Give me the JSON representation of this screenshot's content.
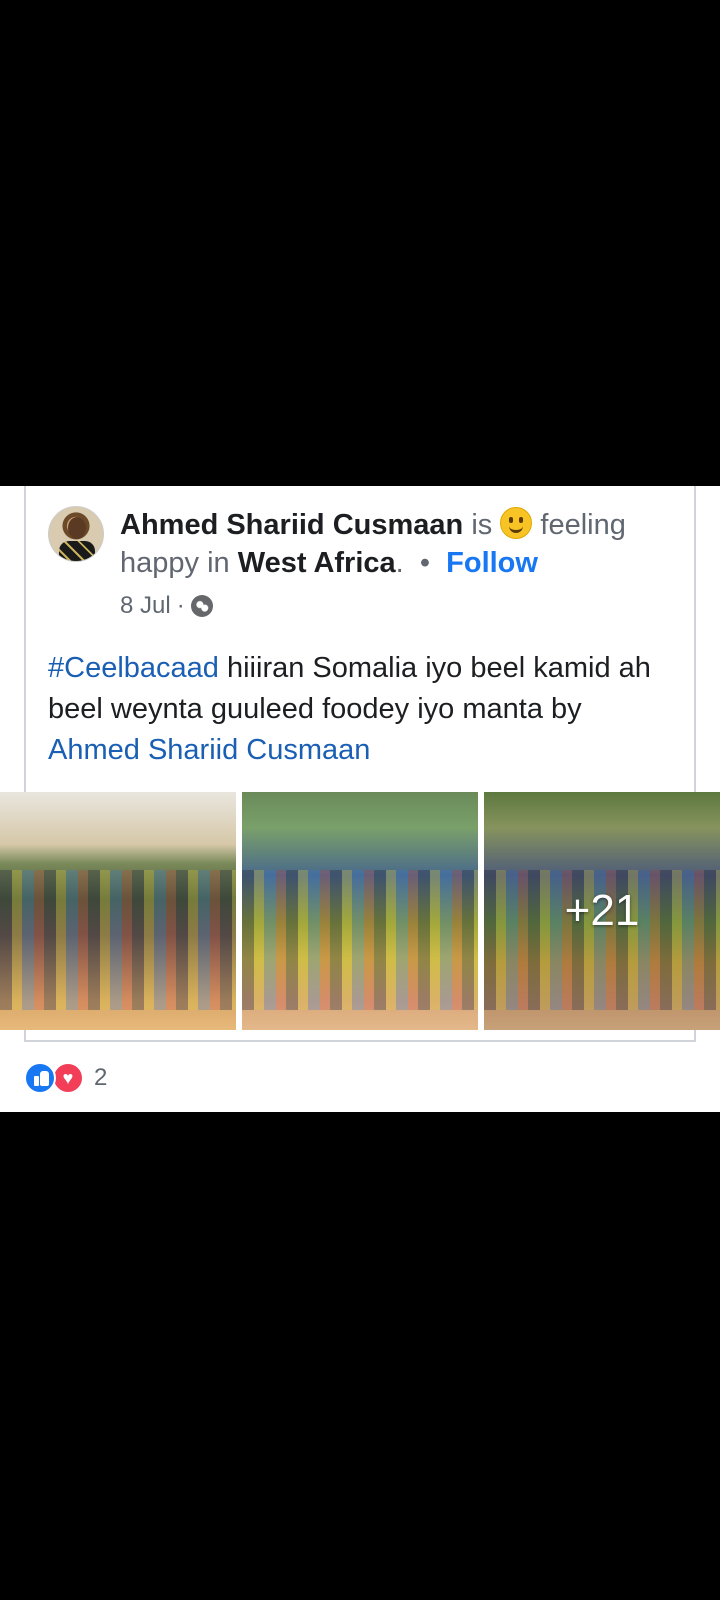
{
  "post": {
    "author": "Ahmed Shariid Cusmaan",
    "is_text": "is",
    "feeling_text": "feeling",
    "feeling_value": "happy",
    "in_text": "in",
    "location": "West Africa",
    "period": ".",
    "separator": "•",
    "follow_label": "Follow",
    "date": "8 Jul",
    "date_separator": "·",
    "privacy_icon": "globe-icon",
    "feeling_icon": "smiley-icon",
    "hashtag": "#Ceelbacaad",
    "body": "hiiiran Somalia iyo beel kamid ah beel weynta guuleed foodey iyo manta",
    "by_text": "by",
    "attribution": "Ahmed Shariid Cusmaan"
  },
  "photos": {
    "more_count": "+21"
  },
  "reactions": {
    "icons": [
      "like-icon",
      "love-icon"
    ],
    "count": "2"
  },
  "colors": {
    "link": "#1877f2",
    "text": "#1c1e21",
    "muted": "#606770",
    "like": "#1877f2",
    "love": "#f33e58"
  }
}
